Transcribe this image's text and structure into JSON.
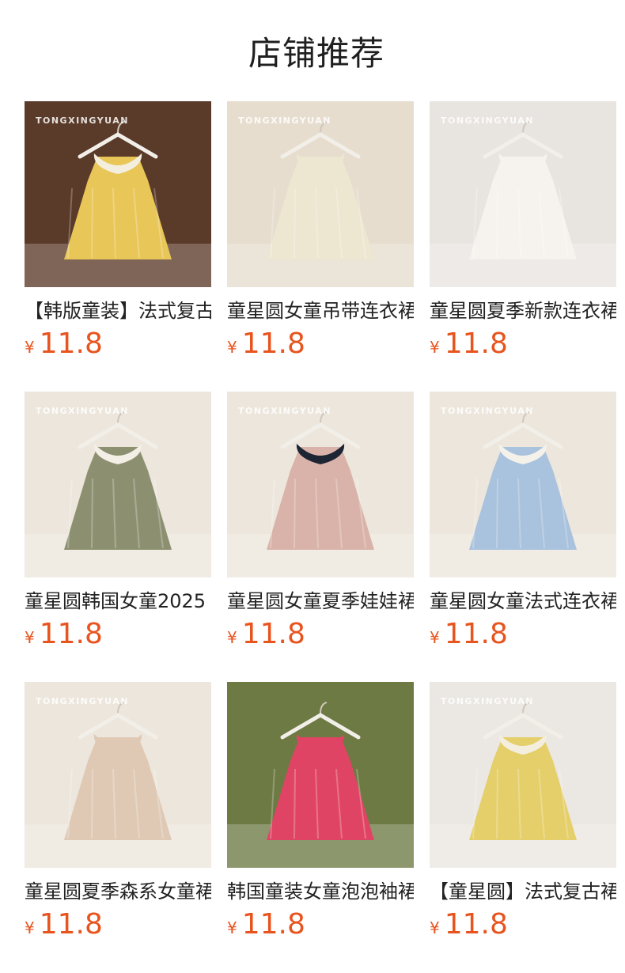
{
  "section": {
    "title": "店铺推荐"
  },
  "products": [
    {
      "name": "【韩版童装】法式复古",
      "currency": "¥",
      "price": "11.8",
      "watermark": "TONGXINGYUAN",
      "bg": "#5a3a28",
      "dress": "#e8c657",
      "collar": "#f4eedf"
    },
    {
      "name": "童星圆女童吊带连衣裙",
      "currency": "¥",
      "price": "11.8",
      "watermark": "TONGXINGYUAN",
      "bg": "#e6ddce",
      "dress": "#ede6d0",
      "collar": "#ede6d0"
    },
    {
      "name": "童星圆夏季新款连衣裙",
      "currency": "¥",
      "price": "11.8",
      "watermark": "TONGXINGYUAN",
      "bg": "#e8e4e0",
      "dress": "#f6f3ee",
      "collar": "#f6f3ee"
    },
    {
      "name": "童星圆韩国女童2025",
      "currency": "¥",
      "price": "11.8",
      "watermark": "TONGXINGYUAN",
      "bg": "#ece6dc",
      "dress": "#8d9070",
      "collar": "#f3efe6"
    },
    {
      "name": "童星圆女童夏季娃娃裙",
      "currency": "¥",
      "price": "11.8",
      "watermark": "TONGXINGYUAN",
      "bg": "#ece6dc",
      "dress": "#d9b3a9",
      "collar": "#1d2433"
    },
    {
      "name": "童星圆女童法式连衣裙",
      "currency": "¥",
      "price": "11.8",
      "watermark": "TONGXINGYUAN",
      "bg": "#ece6dc",
      "dress": "#a9c2dd",
      "collar": "#f4f1ea"
    },
    {
      "name": "童星圆夏季森系女童裙",
      "currency": "¥",
      "price": "11.8",
      "watermark": "TONGXINGYUAN",
      "bg": "#ece6dc",
      "dress": "#dfc9b5",
      "collar": "#dfc9b5"
    },
    {
      "name": "韩国童装女童泡泡袖裙",
      "currency": "¥",
      "price": "11.8",
      "watermark": "",
      "bg": "#6d7a44",
      "dress": "#e04464",
      "collar": "#e04464"
    },
    {
      "name": "【童星圆】法式复古裙",
      "currency": "¥",
      "price": "11.8",
      "watermark": "TONGXINGYUAN",
      "bg": "#ebe7e2",
      "dress": "#e5cf6a",
      "collar": "#f4eedf"
    }
  ]
}
